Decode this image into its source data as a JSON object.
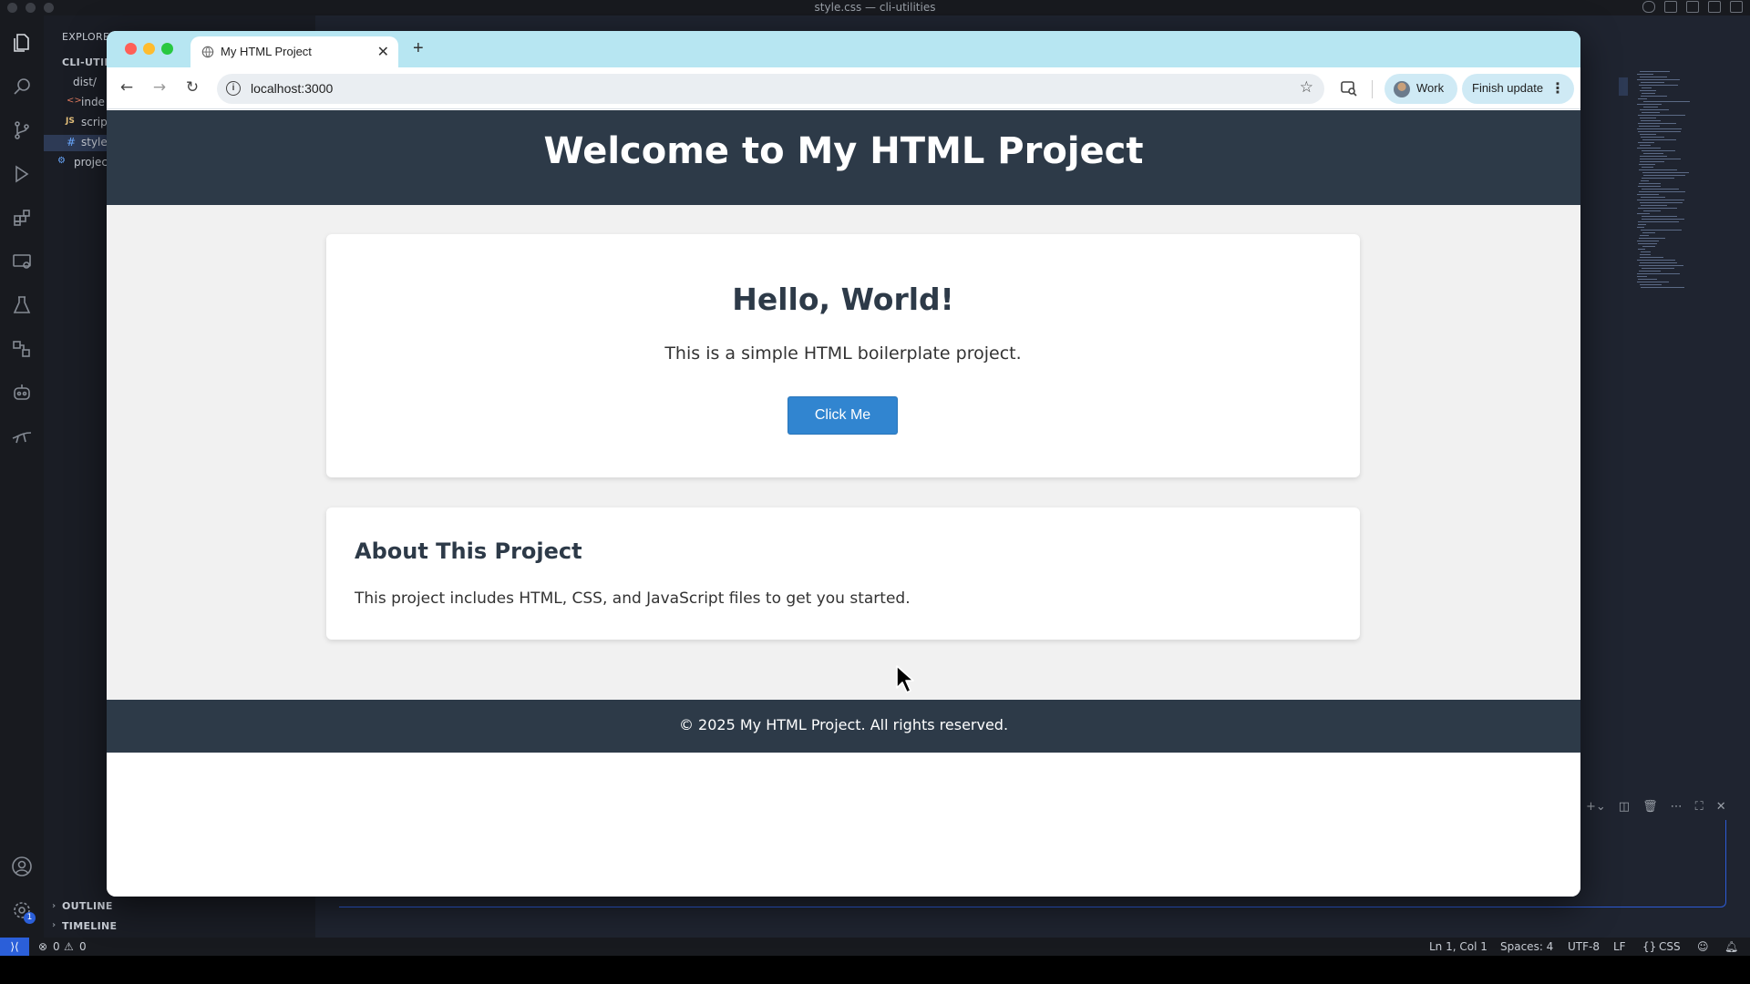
{
  "vscode": {
    "window_title": "style.css — cli-utilities",
    "sidebar": {
      "explorer_label": "EXPLORER",
      "root": "CLI-UTILI",
      "folder": "dist/",
      "files": [
        "inde",
        "scrip",
        "style",
        "projec"
      ],
      "file_badges": [
        "<>",
        "JS",
        "#",
        "⚙"
      ],
      "outline_label": "OUTLINE",
      "timeline_label": "TIMELINE"
    },
    "settings_badge": "1",
    "status_bar": {
      "errors": "0",
      "warnings": "0",
      "cursor_position": "Ln 1, Col 1",
      "indentation": "Spaces: 4",
      "encoding": "UTF-8",
      "line_ending": "LF",
      "language": "CSS"
    }
  },
  "browser": {
    "tab_title": "My HTML Project",
    "url": "localhost:3000",
    "profile_label": "Work",
    "update_label": "Finish update"
  },
  "page": {
    "header_title": "Welcome to My HTML Project",
    "card1": {
      "heading": "Hello, World!",
      "text": "This is a simple HTML boilerplate project.",
      "button_label": "Click Me"
    },
    "card2": {
      "heading": "About This Project",
      "text": "This project includes HTML, CSS, and JavaScript files to get you started."
    },
    "footer_text": "© 2025 My HTML Project. All rights reserved."
  },
  "colors": {
    "header_bg": "#2d3a48",
    "button_bg": "#3185d0",
    "tabbar_bg": "#b7e6f2",
    "status_remote": "#2b5fd9"
  },
  "icons": [
    "files-icon",
    "search-icon",
    "source-control-icon",
    "run-debug-icon",
    "extensions-icon",
    "remote-explorer-icon",
    "testing-icon",
    "containers-icon",
    "copilot-icon",
    "deploy-icon",
    "account-icon",
    "settings-gear-icon"
  ]
}
